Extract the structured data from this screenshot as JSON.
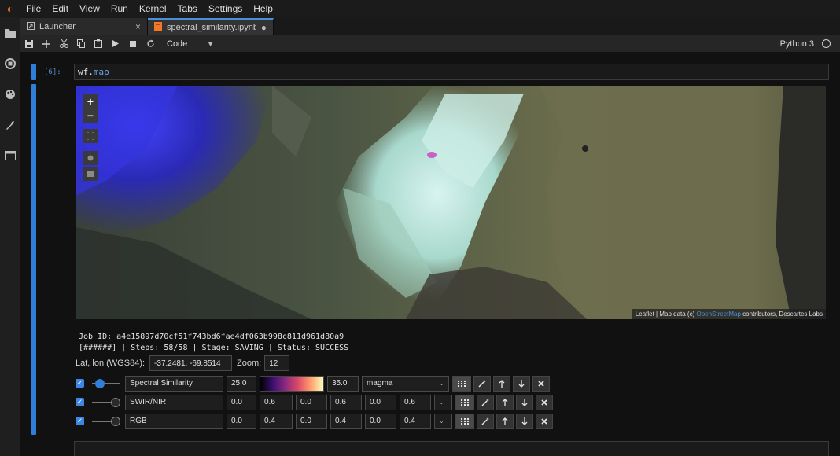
{
  "menubar": {
    "items": [
      "File",
      "Edit",
      "View",
      "Run",
      "Kernel",
      "Tabs",
      "Settings",
      "Help"
    ]
  },
  "sidebar": {
    "icons": [
      "folder-icon",
      "running-icon",
      "palette-icon",
      "wrench-icon",
      "tabs-icon"
    ]
  },
  "tabs": [
    {
      "label": "Launcher",
      "close": "×"
    },
    {
      "label": "spectral_similarity.ipynb",
      "close": "●"
    }
  ],
  "toolbar": {
    "cell_type": "Code",
    "kernel": "Python 3"
  },
  "cell": {
    "prompt": "[6]:",
    "code_obj": "wf",
    "code_dot": ".",
    "code_attr": "map"
  },
  "map": {
    "zoom_in": "+",
    "zoom_out": "−",
    "attribution_prefix": "Leaflet | Map data (c) ",
    "attribution_link": "OpenStreetMap",
    "attribution_suffix": " contributors, Descartes Labs"
  },
  "job": {
    "line1": "Job ID: a4e15897d70cf51f743bd6fae4df063b998c811d961d80a9",
    "line2": "[######] | Steps: 58/58 | Stage: SAVING | Status: SUCCESS"
  },
  "coords": {
    "label": "Lat, lon (WGS84):",
    "value": "-37.2481, -69.8514",
    "zoom_label": "Zoom:",
    "zoom_value": "12"
  },
  "layers": [
    {
      "name": "Spectral Similarity",
      "vmin": "25.0",
      "vmax": "35.0",
      "colormap": "magma"
    },
    {
      "name": "SWIR/NIR",
      "ranges": [
        "0.0",
        "0.6",
        "0.0",
        "0.6",
        "0.0",
        "0.6"
      ]
    },
    {
      "name": "RGB",
      "ranges": [
        "0.0",
        "0.4",
        "0.0",
        "0.4",
        "0.0",
        "0.4"
      ]
    }
  ],
  "colors": {
    "accent": "#2f7fd9",
    "tab_notebook_icon": "#f37726"
  }
}
